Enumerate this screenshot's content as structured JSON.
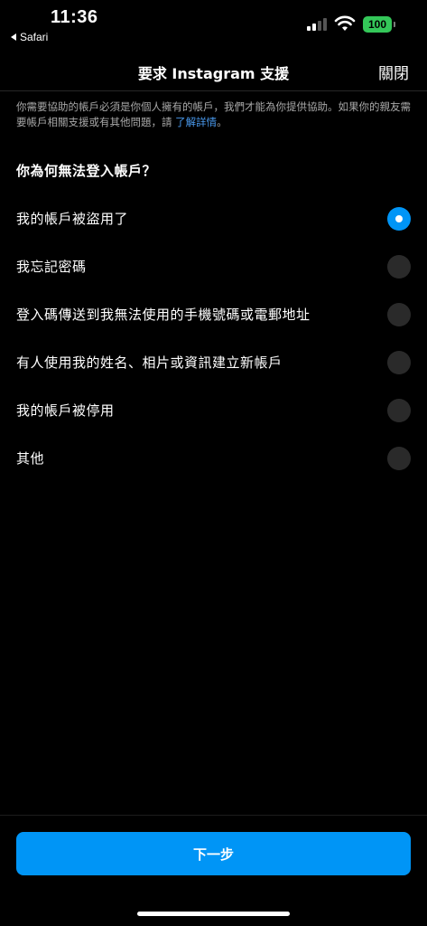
{
  "status_bar": {
    "time": "11:36",
    "back_app": "Safari",
    "battery": "100",
    "battery_color": "#34c759"
  },
  "header": {
    "title": "要求 Instagram 支援",
    "close_label": "關閉"
  },
  "info": {
    "text": "你需要協助的帳戶必須是你個人擁有的帳戶，我們才能為你提供協助。如果你的親友需要帳戶相關支援或有其他問題，請 ",
    "link_text": "了解詳情",
    "suffix": "。"
  },
  "question": "你為何無法登入帳戶？",
  "options": [
    {
      "label": "我的帳戶被盜用了",
      "selected": true
    },
    {
      "label": "我忘記密碼",
      "selected": false
    },
    {
      "label": "登入碼傳送到我無法使用的手機號碼或電郵地址",
      "selected": false
    },
    {
      "label": "有人使用我的姓名、相片或資訊建立新帳戶",
      "selected": false
    },
    {
      "label": "我的帳戶被停用",
      "selected": false
    },
    {
      "label": "其他",
      "selected": false
    }
  ],
  "next_button": "下一步",
  "accent_color": "#0095f6",
  "link_color": "#4a9bf0"
}
